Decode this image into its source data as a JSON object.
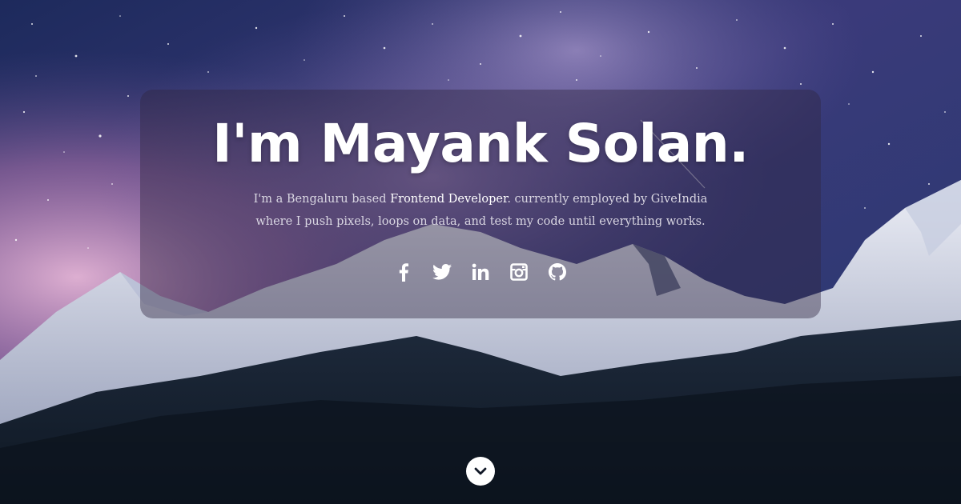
{
  "hero": {
    "title": "I'm Mayank Solan.",
    "intro": {
      "prefix": "I'm a Bengaluru based ",
      "role": "Frontend Developer",
      "suffix": ". currently employed by GiveIndia",
      "line2": "where I push pixels, loops on data, and test my code until everything works."
    }
  },
  "social_links": [
    {
      "icon": "facebook-icon"
    },
    {
      "icon": "twitter-icon"
    },
    {
      "icon": "linkedin-icon"
    },
    {
      "icon": "instagram-icon"
    },
    {
      "icon": "github-icon"
    }
  ],
  "scroll_button": {
    "icon": "chevron-down-icon"
  },
  "colors": {
    "card_overlay": "rgba(48,38,64,0.42)",
    "text_primary": "#ffffff",
    "text_secondary": "#d9d6e2"
  }
}
